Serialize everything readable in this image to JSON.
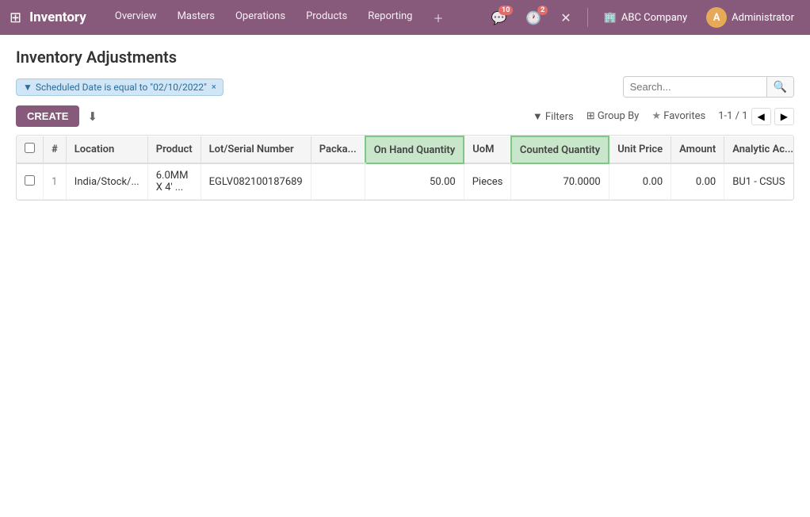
{
  "topnav": {
    "app_icon": "⊞",
    "brand": "Inventory",
    "menu_items": [
      {
        "label": "Overview"
      },
      {
        "label": "Masters"
      },
      {
        "label": "Operations"
      },
      {
        "label": "Products"
      },
      {
        "label": "Reporting"
      }
    ],
    "add_icon": "＋",
    "messages_count": "10",
    "activity_count": "2",
    "close_icon": "✕",
    "company": "ABC Company",
    "user_initial": "A",
    "user_name": "Administrator"
  },
  "page": {
    "title": "Inventory Adjustments"
  },
  "filter_bar": {
    "filter_icon": "▼",
    "filter_label": "Scheduled Date is equal to \"02/10/2022\"",
    "filter_remove": "×",
    "search_placeholder": "Search..."
  },
  "action_bar": {
    "create_label": "CREATE",
    "download_icon": "⬇",
    "filters_label": "Filters",
    "group_by_label": "Group By",
    "favorites_label": "Favorites",
    "pagination": "1-1 / 1"
  },
  "table": {
    "columns": [
      {
        "key": "num",
        "label": "#",
        "type": "num"
      },
      {
        "key": "location",
        "label": "Location"
      },
      {
        "key": "product",
        "label": "Product"
      },
      {
        "key": "lot",
        "label": "Lot/Serial Number"
      },
      {
        "key": "package",
        "label": "Packa..."
      },
      {
        "key": "on_hand",
        "label": "On Hand Quantity",
        "highlight": true
      },
      {
        "key": "uom",
        "label": "UoM"
      },
      {
        "key": "counted",
        "label": "Counted Quantity",
        "highlight": true
      },
      {
        "key": "unit_price",
        "label": "Unit Price"
      },
      {
        "key": "amount",
        "label": "Amount"
      },
      {
        "key": "analytic",
        "label": "Analytic Ac..."
      }
    ],
    "rows": [
      {
        "num": "1",
        "location": "India/Stock/...",
        "product": "6.0MM X 4' ...",
        "lot": "EGLV082100187689",
        "package": "",
        "on_hand": "50.00",
        "uom": "Pieces",
        "counted": "70.0000",
        "unit_price": "0.00",
        "amount": "0.00",
        "analytic": "BU1 - CSUS"
      }
    ]
  }
}
